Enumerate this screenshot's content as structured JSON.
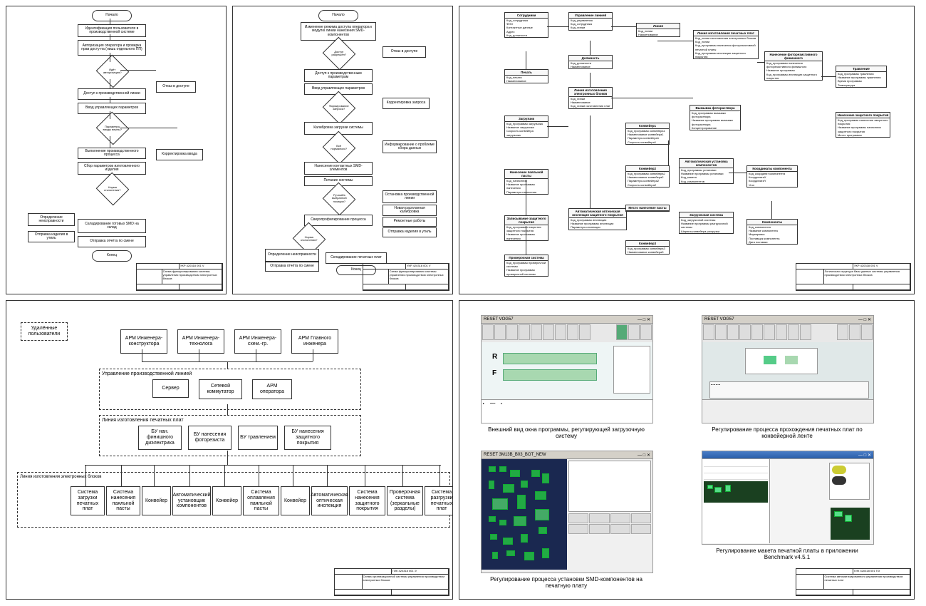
{
  "sheets": {
    "s1": {
      "code": "УКР 420318 001 V",
      "title": "Схема функционирования системы управления производством электронных блоков",
      "nodes": {
        "start": "Начало",
        "n1": "Идентификация пользователя в производственной системе",
        "n2": "Авторизация оператора и проверка прав досту-па (лишь отдельного ПП)",
        "d1": "Идёт авторизация?",
        "n3": "Доступ к производственной линии",
        "n4": "Отказ в доступе",
        "n5": "Ввод управляющих параметров",
        "d2": "Параметры вводы верны?",
        "n6": "Выполнение производственного процесса",
        "n7": "Корректировка ввода",
        "n8": "Сбор параметров изготовленного изделия",
        "d3": "Норма отклонения?",
        "n9": "Определение неисправности",
        "n10": "Отправка изделия в утиль",
        "n11": "Складирование готовых SMD на склад",
        "n12": "Отправка отчёта по смене",
        "end": "Конец"
      }
    },
    "s2": {
      "code": "УКР 420318 001 V",
      "title": "Схема функционирования системы управления производством электронных блоков",
      "nodes": {
        "start": "Начало",
        "n1": "Изменение режима доступа оператора к модулю линии нанесения SMD-компонентов",
        "d1": "Доступ разрешён?",
        "n2": "Отказ в доступе",
        "n3": "Доступ к производственным параметрам",
        "n4": "Ввод управляющих параметров",
        "d2": "Формирование запроса?",
        "n5": "Корректировка запроса",
        "n6": "Калибровка загрузки системы",
        "d3": "Всё нормально?",
        "n7": "Информирование о проблеме сбора данных",
        "n8": "Нанесение контактных SMD-элементов",
        "n9": "Питание системы",
        "d4": "Ручной/в выбранной позиции?",
        "n10": "Остановка производственной линии",
        "n11": "Сверхпрофилирование процесса",
        "n12": "Новая распланная калибровка",
        "n13": "Ремонтные работы",
        "n14": "Отправка изделия в утиль",
        "d5": "Норма отклонения?",
        "n15": "Определение неисправности",
        "n16": "Отправка отчёта по смене",
        "n17": "Складирование печатных плат",
        "end": "Конец"
      }
    },
    "s3": {
      "code": "УКР 420318 001 V",
      "title": "Логическая структура базы данных системы управления производством электронных блоков",
      "entities": {
        "e1": {
          "name": "Сотрудники",
          "attrs": [
            "Код_сотрудника",
            "ФИО",
            "Контактные данные",
            "Адрес",
            "Код_должности"
          ]
        },
        "e2": {
          "name": "Управление линией",
          "attrs": [
            "Код_управления",
            "Код_сотрудника",
            "Код_линии"
          ]
        },
        "e3": {
          "name": "Линия",
          "attrs": [
            "Код_линии",
            "Наименование"
          ]
        },
        "e4": {
          "name": "Печать",
          "attrs": [
            "Код_печати",
            "Наименование"
          ]
        },
        "e5": {
          "name": "Должность",
          "attrs": [
            "Код_должности",
            "Наименование"
          ]
        },
        "e6": {
          "name": "Линия изготовления электронных блоков",
          "attrs": [
            "Код_линии",
            "Наименование",
            "Код_линии изготовления плат"
          ]
        },
        "e7": {
          "name": "Линия изготовления печатных плат",
          "attrs": [
            "Код_линии изготовления электронных блоков",
            "Код_линии",
            "Код_программы нанесения фоторезистивной печатной платы",
            "Код_программы инспекции защитного покрытия"
          ]
        },
        "e8": {
          "name": "Нанесение фоторезистивного финишного",
          "attrs": [
            "Код_программы нанесения фоторезистивного финишного",
            "Название программы",
            "Код_программы инспекции защитного покрытия"
          ]
        },
        "e9": {
          "name": "Травление",
          "attrs": [
            "Код_программы травления",
            "Название программы травления",
            "Время программы",
            "Температура"
          ]
        },
        "e10": {
          "name": "Нанесение защитного покрытия",
          "attrs": [
            "Код_программа нанесения защитного покрытия",
            "Название программы нанесения защитного покрытия",
            "Место программы"
          ]
        },
        "e11": {
          "name": "Загрузчик",
          "attrs": [
            "Код_программы загрузчика",
            "Название загрузчика",
            "Скорость конвейера загрузчика"
          ]
        },
        "e12": {
          "name": "Конвейер1",
          "attrs": [
            "Код_программы конвейера1",
            "Наименование конвейера1",
            "Параметры конвейера1",
            "Скорость конвейера1"
          ]
        },
        "e13": {
          "name": "Конвейер2",
          "attrs": [
            "Код_программы конвейера2",
            "Наименование конвейера2",
            "Параметры конвейера2",
            "Скорость конвейера2"
          ]
        },
        "e14": {
          "name": "Вымывка фотораствора",
          "attrs": [
            "Код_программы вымывки фотораствора",
            "Название программы вымывки фотораствора",
            "Концентрирование"
          ]
        },
        "e15": {
          "name": "Нанесение паяльной пасты",
          "attrs": [
            "Код_нанесения",
            "Название программы нанесения",
            "Параметры нанесения"
          ]
        },
        "e16": {
          "name": "Записывание защитного покрытия",
          "attrs": [
            "Код_программы покрытия защитного покрытия",
            "Название программы нанесения"
          ]
        },
        "e17": {
          "name": "Автоматическая оптическая инспекция защитного покрытия",
          "attrs": [
            "Код_программы инспекции",
            "Название программы инспекции",
            "Параметры инспекции"
          ]
        },
        "e18": {
          "name": "Конвейер3",
          "attrs": [
            "Код_программы конвейера3",
            "Наименование конвейера3"
          ]
        },
        "e19": {
          "name": "Автоматическая установка компонентов",
          "attrs": [
            "Код_программы установки",
            "Название программы установки",
            "Код_макета",
            "Код_компонентов"
          ]
        },
        "e20": {
          "name": "Координаты компонента",
          "attrs": [
            "Код_координат компонента",
            "КоординатаX",
            "КоординатаY",
            "Угол"
          ]
        },
        "e21": {
          "name": "Компоненты",
          "attrs": [
            "Код_компонента",
            "Название компонента",
            "Маркировка",
            "Поставщик компонента",
            "Дата поставки"
          ]
        },
        "e22": {
          "name": "Проверочная система",
          "attrs": [
            "Код_программы проверочной системы",
            "Название программы проверочной системы"
          ]
        },
        "e23": {
          "name": "Загрузочная система",
          "attrs": [
            "Код_загрузочной системы",
            "Название программы разгрузочной системы",
            "Ширина конвейера разгрузки"
          ]
        },
        "e24": {
          "name": "Место нанесение пасты",
          "attrs": []
        }
      }
    },
    "s4": {
      "code": "ГИК 420318 001 Э",
      "title": "Схема организационной системы управления производством электронных блоков",
      "boxes": {
        "b0": "Удалённые пользователи",
        "b1": "АРМ Инженера-конструктора",
        "b2": "АРМ Инженера-технолога",
        "b3": "АРМ Инженера-схем.-гр.",
        "b4": "АРМ Главного инженера",
        "b5": "Управление производственной линией",
        "b6": "Сервер",
        "b7": "Сетевой коммутатор",
        "b8": "АРМ оператора",
        "b9": "Линия изготовления печатных плат",
        "b10": "БУ нан. финишного диэлектрика",
        "b11": "БУ нанесения фоторезиста",
        "b12": "БУ травлением",
        "b13": "БУ нанесения защитного покрытия",
        "b14": "Линия изготовления электронных блоков",
        "c1": "Система загрузки печатных плат",
        "c2": "Система нанесения паяльной пасты",
        "c3": "Конвейер",
        "c4": "Автоматический установщик компонентов",
        "c5": "Конвейер",
        "c6": "Система оплавления паяльной пасты",
        "c7": "Конвейер",
        "c8": "Автоматическая оптическая инспекция",
        "c9": "Система нанесения защитного покрытия",
        "c10": "Проверочная система (зеркальные разделы)",
        "c11": "Система разгрузки печатных плат"
      }
    },
    "s5": {
      "code": "ГИК 420318 001 ПЗ",
      "title": "Система автоматизированного управления производством печатных плат",
      "windows": {
        "w1": "RESET VOG57",
        "w2": "RESET VOG57",
        "w3": "RESET 3M13B_B03_BOT_NEW",
        "w4": ""
      },
      "captions": {
        "c1": "Внешний вид окна программы, регулирующей загрузочную систему",
        "c2": "Регулирование процесса прохождения печатных плат по конвейерной ленте",
        "c3": "Регулирование процесса установки SMD-компонентов на печатную плату",
        "c4": "Регулирование макета печатной платы в приложении Benchmark v4.5.1"
      },
      "labels": {
        "R": "R",
        "F": "F"
      }
    }
  }
}
